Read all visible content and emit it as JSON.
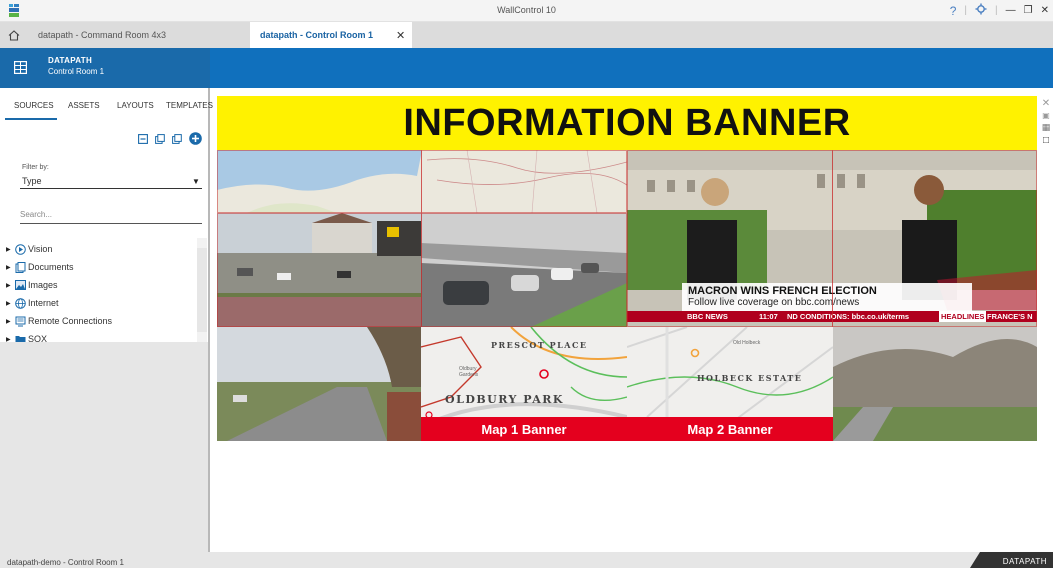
{
  "window": {
    "title": "WallControl 10",
    "controls": [
      "?",
      "|",
      "gear",
      "|",
      "minimize",
      "restore",
      "close"
    ]
  },
  "tabs": [
    {
      "label": "datapath - Command Room 4x3",
      "active": false
    },
    {
      "label": "datapath  - Control Room 1",
      "active": true
    }
  ],
  "sidebar_header": {
    "title": "DATAPATH",
    "subtitle": "Control Room 1"
  },
  "sidebar": {
    "tabs": [
      {
        "label": "SOURCES",
        "active": true
      },
      {
        "label": "ASSETS",
        "active": false
      },
      {
        "label": "LAYOUTS",
        "active": false
      },
      {
        "label": "TEMPLATES",
        "active": false
      }
    ],
    "filter": {
      "label": "Filter by:",
      "value": "Type"
    },
    "search": {
      "placeholder": "Search..."
    },
    "tree": [
      {
        "label": "Vision",
        "icon": "vision-icon"
      },
      {
        "label": "Documents",
        "icon": "documents-icon"
      },
      {
        "label": "Images",
        "icon": "images-icon"
      },
      {
        "label": "Internet",
        "icon": "globe-icon"
      },
      {
        "label": "Remote Connections",
        "icon": "remote-connections-icon"
      },
      {
        "label": "SOX",
        "icon": "folder-icon"
      }
    ]
  },
  "wall": {
    "banner": "INFORMATION BANNER",
    "news": {
      "headline": "MACRON WINS FRENCH ELECTION",
      "subline": "Follow live coverage on bbc.com/news",
      "logo": "BBC NEWS",
      "time": "11:07",
      "ticker": "ND CONDITIONS: bbc.co.uk/terms",
      "headlines_tag": "HEADLINES",
      "country_tag": "FRANCE'S N"
    },
    "map1": {
      "place_top": "PRESCOT PLACE",
      "place_small": "Oldbury Gardens",
      "place_main": "OLDBURY PARK",
      "banner": "Map 1 Banner"
    },
    "map2": {
      "place_small": "Old Holbeck",
      "place_main": "HOLBECK ESTATE",
      "banner": "Map 2 Banner"
    }
  },
  "status": {
    "text": "datapath-demo - Control Room 1",
    "brand": "DATAPATH"
  },
  "colors": {
    "header_blue": "#1a6aaa",
    "topbar_blue": "#1070bd",
    "banner_yellow": "#fff200",
    "map_banner_red": "#e4001e"
  }
}
